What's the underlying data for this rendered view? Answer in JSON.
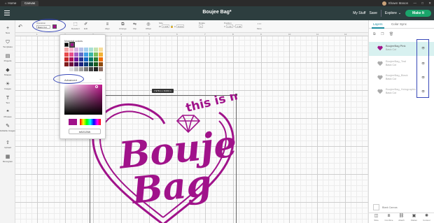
{
  "os_tabs": {
    "home": "Home",
    "canvas": "Canvas"
  },
  "os_user": "Shawn Mason",
  "header": {
    "title": "Boujee Bag*",
    "my_stuff": "My Stuff",
    "save": "Save",
    "machine": "Explore",
    "make_it": "Make It"
  },
  "left_tools": [
    "New",
    "Templates",
    "Projects",
    "Shapes",
    "Images",
    "Text",
    "Phrases",
    "Editable Images",
    "Upload",
    "Monogram"
  ],
  "toolbar": {
    "operation_label": "Operation",
    "operation_value": "Basic Cut",
    "items": [
      "Deselect",
      "Edit",
      "Align",
      "Arrange",
      "Flip",
      "Offset"
    ],
    "size_label": "Size",
    "w_value": "7.978",
    "h_value": "8.033",
    "rotate_label": "Rotate",
    "rotate_value": "0",
    "position_label": "Position",
    "x_value": "1.00",
    "y_value": "0.98",
    "more_label": "More"
  },
  "ruler": [
    "1",
    "2",
    "3",
    "4",
    "5",
    "6",
    "7",
    "8",
    "9",
    "10",
    "11",
    "12"
  ],
  "canvas": {
    "dimension_tip": "7.978 in x 8.033 in"
  },
  "design": {
    "line1": "this is my",
    "line2": "Boujee",
    "line3": "Bag",
    "color": "#a0128a"
  },
  "color_picker": {
    "title": "Material colors",
    "advanced": "Advanced",
    "hex": "#A0128A",
    "swatches": [
      "#f4a6a6",
      "#f7b6cf",
      "#d8b4e2",
      "#b9c2ea",
      "#a5cfee",
      "#a8e0d5",
      "#c4e3b0",
      "#f7dc9a",
      "#e84c4c",
      "#e74e8a",
      "#a45bc4",
      "#5e6ec7",
      "#3d9ee6",
      "#39b7a4",
      "#7cc05a",
      "#f2b134",
      "#c62828",
      "#ad1457",
      "#6a1b9a",
      "#283593",
      "#1565c0",
      "#00796b",
      "#2e7d32",
      "#ef6c00",
      "#7f1d1d",
      "#6d0b3a",
      "#3d0e5c",
      "#1a237e",
      "#0d3c7a",
      "#004d40",
      "#1b5e20",
      "#8d4a0f",
      "#ffffff",
      "#e0e0e0",
      "#bdbdbd",
      "#9e9e9e",
      "#757575",
      "#424242",
      "#212121",
      "#8d6e63"
    ]
  },
  "panel": {
    "tabs": [
      "Layers",
      "Color Sync"
    ],
    "layers": [
      {
        "name": "BoujeeBag Pink",
        "sub": "Basic Cut",
        "visible": "👁"
      },
      {
        "name": "BoujeeBag_Teal",
        "sub": "Basic Cut",
        "visible": "👁"
      },
      {
        "name": "BoujeeBag_Black",
        "sub": "Basic Cut",
        "visible": "👁"
      },
      {
        "name": "BoujeeBag_Holographic",
        "sub": "Basic Cut",
        "visible": "👁"
      }
    ],
    "blank_canvas": "Blank Canvas",
    "bottom_tools": [
      "Slice",
      "Combine",
      "Attach",
      "Flatten",
      "Contour"
    ]
  }
}
